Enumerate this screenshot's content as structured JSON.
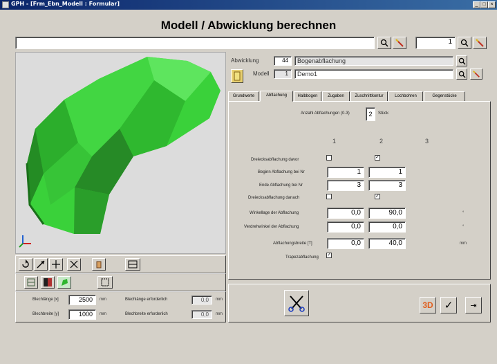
{
  "window": {
    "title": "GPH - [Frm_Ebn_Modell : Formular]",
    "minimize": "_",
    "maximize": "□",
    "close": "×"
  },
  "header": {
    "title": "Modell / Abwicklung berechnen"
  },
  "topbar": {
    "search_value": "",
    "number_value": "1"
  },
  "abwicklung": {
    "label": "Abwicklung",
    "id": "44",
    "name": "Bogenabflachung"
  },
  "modell": {
    "label": "Modell",
    "id": "1",
    "name": "Demo1"
  },
  "tabs": [
    {
      "label": "Grundwerte"
    },
    {
      "label": "Abflachung"
    },
    {
      "label": "Halbbogen"
    },
    {
      "label": "Zugaben"
    },
    {
      "label": "Zuschnittkontur"
    },
    {
      "label": "Lochbohren"
    },
    {
      "label": "Gegenstücke"
    }
  ],
  "abflachung": {
    "count_label": "Anzahl Abflachungen (0-3)",
    "count_value": "2",
    "count_unit": "Stück",
    "col_headers": [
      "1",
      "2",
      "3"
    ],
    "rows": {
      "dreieck_davor": {
        "label": "Dreiecksabflachung davor",
        "c1": false,
        "c2": true
      },
      "beginn": {
        "label": "Beginn Abflachung bei Nr",
        "c1": "1",
        "c2": "1"
      },
      "ende": {
        "label": "Ende Abflachung bei Nr",
        "c1": "3",
        "c2": "3"
      },
      "dreieck_danach": {
        "label": "Dreiecksabflachung danach",
        "c1": false,
        "c2": true
      },
      "winkellage": {
        "label": "Winkellage der Abflachung",
        "c1": "0,0",
        "c2": "90,0",
        "unit": "°"
      },
      "verdrehwinkel": {
        "label": "Verdrehwinkel der Abflachung",
        "c1": "0,0",
        "c2": "0,0",
        "unit": "°"
      },
      "breite": {
        "label": "Abflachungsbreite [T]",
        "c1": "0,0",
        "c2": "40,0",
        "unit": "mm"
      },
      "trapez": {
        "label": "Trapezabflachung",
        "c1": true
      }
    }
  },
  "sheet": {
    "blechlaenge_label": "Blechlänge [x]",
    "blechlaenge_value": "2500",
    "blechlaenge_unit": "mm",
    "blechbreite_label": "Blechbreite [y]",
    "blechbreite_value": "1000",
    "blechbreite_unit": "mm",
    "laenge_erf_label": "Blechlänge erforderlich",
    "laenge_erf_value": "0,0",
    "laenge_erf_unit": "mm",
    "breite_erf_label": "Blechbreite erforderlich",
    "breite_erf_value": "0,0",
    "breite_erf_unit": "mm"
  },
  "actions": {
    "button_3d": "3D",
    "ok": "✓",
    "exit": "⇥"
  },
  "colors": {
    "model_green": "#33cc33",
    "model_dark": "#1e7a1e",
    "title_blue": "#0a246a"
  },
  "icons": [
    "search-icon",
    "wand-icon",
    "rotate-icon",
    "scissors-icon",
    "check-icon",
    "exit-icon"
  ]
}
